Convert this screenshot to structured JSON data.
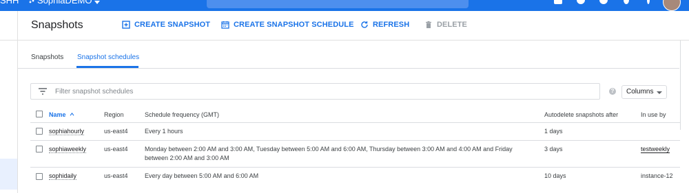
{
  "topbar": {
    "brand_partial": "SHH",
    "project": "SophiaDEMO"
  },
  "header": {
    "title": "Snapshots",
    "actions": {
      "create_snapshot": "CREATE SNAPSHOT",
      "create_schedule": "CREATE SNAPSHOT SCHEDULE",
      "refresh": "REFRESH",
      "delete": "DELETE"
    }
  },
  "tabs": [
    {
      "label": "Snapshots",
      "active": false
    },
    {
      "label": "Snapshot schedules",
      "active": true
    }
  ],
  "filter": {
    "placeholder": "Filter snapshot schedules",
    "columns_label": "Columns",
    "help": "?"
  },
  "table": {
    "headers": {
      "name": "Name",
      "sort_indicator": "^",
      "region": "Region",
      "frequency": "Schedule frequency (GMT)",
      "autodelete": "Autodelete snapshots after",
      "in_use_by": "In use by"
    },
    "rows": [
      {
        "name": "sophiahourly",
        "region": "us-east4",
        "frequency": "Every 1 hours",
        "autodelete": "1 days",
        "in_use_by": ""
      },
      {
        "name": "sophiaweekly",
        "region": "us-east4",
        "frequency": "Monday between 2:00 AM and 3:00 AM, Tuesday between 5:00 AM and 6:00 AM, Thursday between 3:00 AM and 4:00 AM and Friday between 2:00 AM and 3:00 AM",
        "autodelete": "3 days",
        "in_use_by": "testweekly"
      },
      {
        "name": "sophidaily",
        "region": "us-east4",
        "frequency": "Every day between 5:00 AM and 6:00 AM",
        "autodelete": "10 days",
        "in_use_by": "instance-12"
      }
    ]
  },
  "colors": {
    "accent": "#1a73e8",
    "text": "#202124",
    "border": "#dadce0"
  }
}
